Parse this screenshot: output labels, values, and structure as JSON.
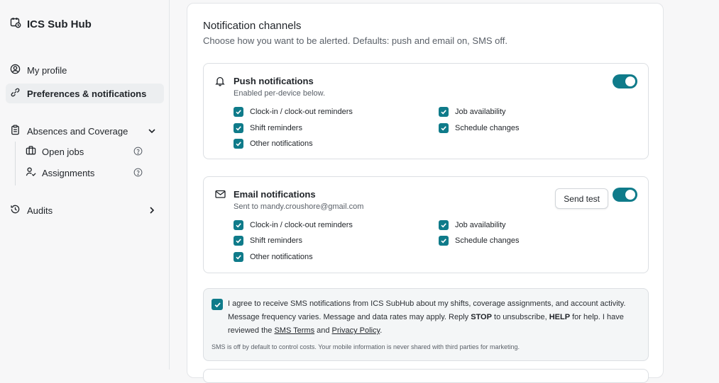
{
  "app": {
    "title": "ICS Sub Hub"
  },
  "sidebar": {
    "my_profile": "My profile",
    "preferences": "Preferences & notifications",
    "absences": "Absences and Coverage",
    "open_jobs": "Open jobs",
    "assignments": "Assignments",
    "audits": "Audits"
  },
  "main": {
    "title": "Notification channels",
    "description": "Choose how you want to be alerted. Defaults: push and email on, SMS off."
  },
  "push": {
    "title": "Push notifications",
    "subtitle": "Enabled per-device below.",
    "enabled": true,
    "options": [
      {
        "label": "Clock-in / clock-out reminders",
        "checked": true
      },
      {
        "label": "Shift reminders",
        "checked": true
      },
      {
        "label": "Other notifications",
        "checked": true
      },
      {
        "label": "Job availability",
        "checked": true
      },
      {
        "label": "Schedule changes",
        "checked": true
      }
    ]
  },
  "email": {
    "title": "Email notifications",
    "subtitle": "Sent to mandy.croushore@gmail.com",
    "send_test": "Send test",
    "enabled": true,
    "options": [
      {
        "label": "Clock-in / clock-out reminders",
        "checked": true
      },
      {
        "label": "Shift reminders",
        "checked": true
      },
      {
        "label": "Other notifications",
        "checked": true
      },
      {
        "label": "Job availability",
        "checked": true
      },
      {
        "label": "Schedule changes",
        "checked": true
      }
    ]
  },
  "sms": {
    "checked": true,
    "text_1": "I agree to receive SMS notifications from ICS SubHub about my shifts, coverage assignments, and account activity. Message frequency varies. Message and data rates may apply. Reply ",
    "stop": "STOP",
    "text_2": " to unsubscribe, ",
    "help": "HELP",
    "text_3": " for help. I have reviewed the ",
    "terms_link": "SMS Terms",
    "text_4": " and ",
    "privacy_link": "Privacy Policy",
    "text_5": ".",
    "fine_print": "SMS is off by default to control costs. Your mobile information is never shared with third parties for marketing."
  },
  "colors": {
    "accent": "#0f7b8a"
  }
}
